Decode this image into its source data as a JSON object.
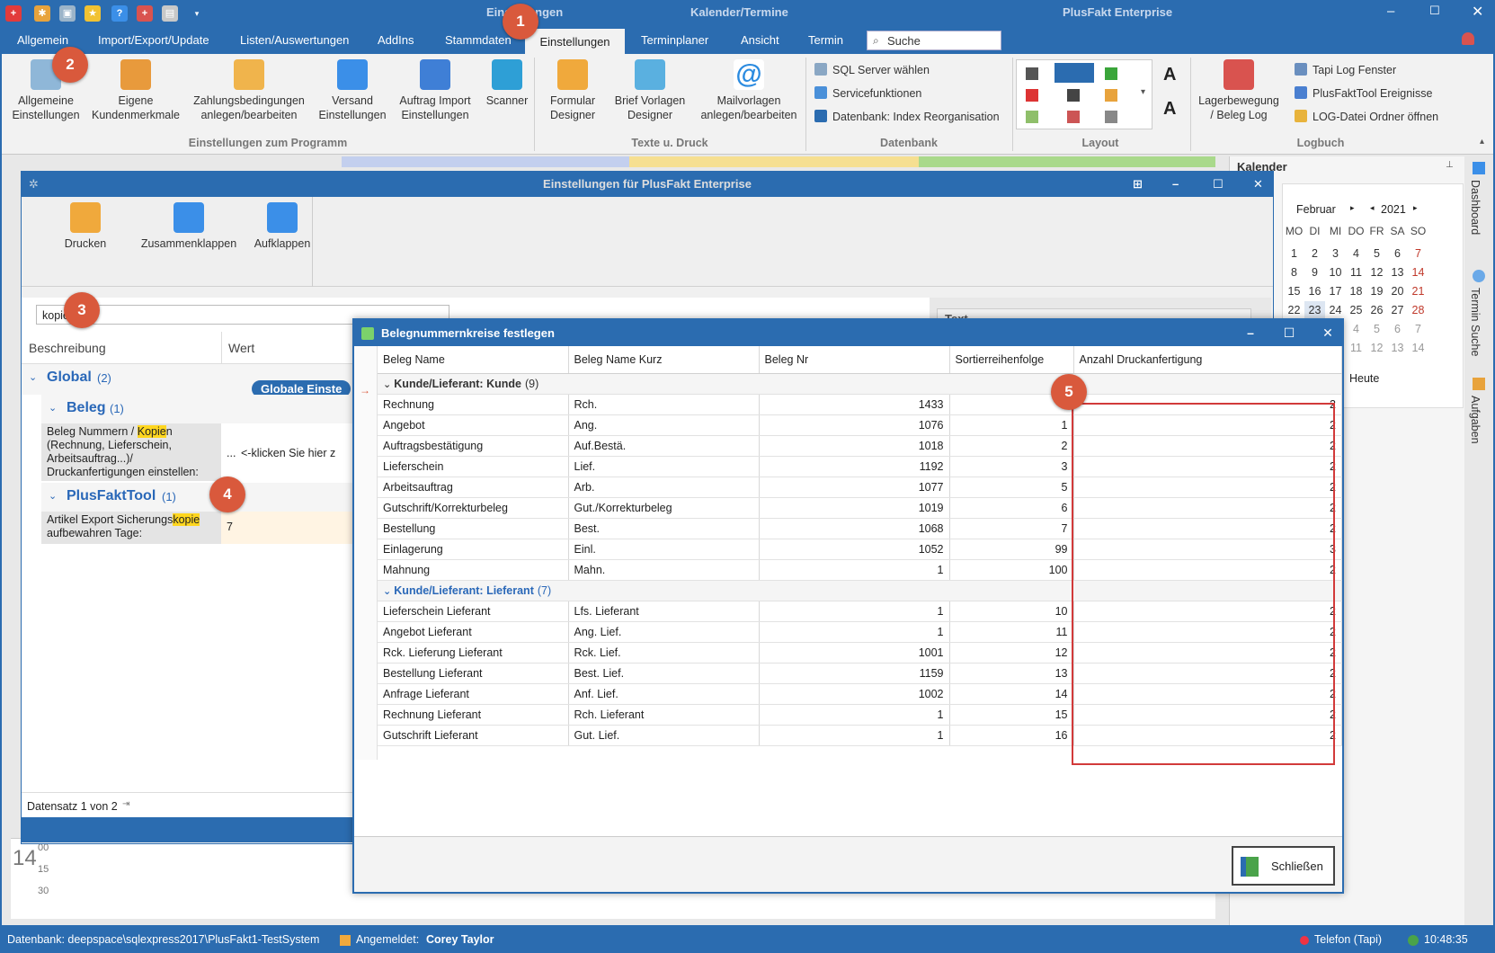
{
  "app": {
    "left_title": "Einstellungen",
    "center_title": "Kalender/Termine",
    "right_title": "PlusFakt Enterprise"
  },
  "menu": {
    "items": [
      "Allgemein",
      "Import/Export/Update",
      "Listen/Auswertungen",
      "AddIns",
      "Stammdaten",
      "Einstellungen",
      "Terminplaner",
      "Ansicht",
      "Termin"
    ],
    "search_placeholder": "Suche"
  },
  "ribbon": {
    "programm": {
      "buttons": [
        "Allgemeine\nEinstellungen",
        "Eigene\nKundenmerkmale",
        "Zahlungsbedingungen\nanlegen/bearbeiten",
        "Versand\nEinstellungen",
        "Auftrag Import\nEinstellungen",
        "Scanner"
      ],
      "label": "Einstellungen zum Programm"
    },
    "texte": {
      "buttons": [
        "Formular\nDesigner",
        "Brief Vorlagen\nDesigner",
        "Mailvorlagen\nanlegen/bearbeiten"
      ],
      "label": "Texte u. Druck"
    },
    "datenbank": {
      "cmds": [
        "SQL Server wählen",
        "Servicefunktionen",
        "Datenbank: Index Reorganisation"
      ],
      "label": "Datenbank"
    },
    "layout": {
      "label": "Layout"
    },
    "logbuch": {
      "button": "Lagerbewegung\n/ Beleg Log",
      "cmds": [
        "Tapi Log Fenster",
        "PlusFaktTool Ereignisse",
        "LOG-Datei Ordner öffnen"
      ],
      "label": "Logbuch"
    }
  },
  "settings_window": {
    "title": "Einstellungen für PlusFakt Enterprise",
    "toolbar": [
      "Drucken",
      "Zusammenklappen",
      "Aufklappen"
    ],
    "search_value": "kopie",
    "col_beschreibung": "Beschreibung",
    "col_wert": "Wert",
    "text_panel": "Text",
    "group_global": "Global",
    "group_global_count": "(2)",
    "globale_tag": "Globale Einste",
    "group_beleg": "Beleg",
    "group_beleg_count": "(1)",
    "row1_desc_a": "Beleg Nummern / ",
    "row1_desc_hl": "Kopie",
    "row1_desc_b": "n (Rechnung, Lieferschein, Arbeitsauftrag...)/ Druckanfertigungen einstellen:",
    "row1_value": "<-klicken Sie hier z",
    "row1_ellipsis": "...",
    "group_tool": "PlusFaktTool",
    "group_tool_count": "(1)",
    "row2_desc_a": "Artikel Export Sicherungs",
    "row2_desc_hl": "kopie",
    "row2_desc_b": " aufbewahren Tage:",
    "row2_value": "7",
    "record_nav": "Datensatz 1 von 2"
  },
  "calendar": {
    "title": "Kalender",
    "month": "Februar",
    "year": "2021",
    "weekdays": [
      "MO",
      "DI",
      "MI",
      "DO",
      "FR",
      "SA",
      "SO"
    ],
    "weeks": [
      [
        "1",
        "2",
        "3",
        "4",
        "5",
        "6",
        "7"
      ],
      [
        "8",
        "9",
        "10",
        "11",
        "12",
        "13",
        "14"
      ],
      [
        "15",
        "16",
        "17",
        "18",
        "19",
        "20",
        "21"
      ],
      [
        "22",
        "23",
        "24",
        "25",
        "26",
        "27",
        "28"
      ],
      [
        "1",
        "2",
        "3",
        "4",
        "5",
        "6",
        "7"
      ],
      [
        "8",
        "9",
        "10",
        "11",
        "12",
        "13",
        "14"
      ]
    ],
    "heute": "Heute"
  },
  "side_tabs": [
    "Dashboard",
    "Termin Suche",
    "Aufgaben"
  ],
  "schedule": {
    "times": [
      "00",
      "15",
      "30"
    ],
    "hour": "14"
  },
  "beleg_dialog": {
    "title": "Belegnummernkreise festlegen",
    "columns": [
      "Beleg Name",
      "Beleg Name Kurz",
      "Beleg Nr",
      "Sortierreihenfolge",
      "Anzahl Druckanfertigung"
    ],
    "groups": [
      {
        "label": "Kunde/Lieferant: Kunde",
        "count": "(9)",
        "rows": [
          [
            "Rechnung",
            "Rch.",
            "1433",
            "0",
            "2"
          ],
          [
            "Angebot",
            "Ang.",
            "1076",
            "1",
            "2"
          ],
          [
            "Auftragsbestätigung",
            "Auf.Bestä.",
            "1018",
            "2",
            "2"
          ],
          [
            "Lieferschein",
            "Lief.",
            "1192",
            "3",
            "2"
          ],
          [
            "Arbeitsauftrag",
            "Arb.",
            "1077",
            "5",
            "2"
          ],
          [
            "Gutschrift/Korrekturbeleg",
            "Gut./Korrekturbeleg",
            "1019",
            "6",
            "2"
          ],
          [
            "Bestellung",
            "Best.",
            "1068",
            "7",
            "2"
          ],
          [
            "Einlagerung",
            "Einl.",
            "1052",
            "99",
            "3"
          ],
          [
            "Mahnung",
            "Mahn.",
            "1",
            "100",
            "2"
          ]
        ]
      },
      {
        "label": "Kunde/Lieferant: Lieferant",
        "count": "(7)",
        "rows": [
          [
            "Lieferschein Lieferant",
            "Lfs. Lieferant",
            "1",
            "10",
            "2"
          ],
          [
            "Angebot Lieferant",
            "Ang. Lief.",
            "1",
            "11",
            "2"
          ],
          [
            "Rck. Lieferung Lieferant",
            "Rck. Lief.",
            "1001",
            "12",
            "2"
          ],
          [
            "Bestellung Lieferant",
            "Best. Lief.",
            "1159",
            "13",
            "2"
          ],
          [
            "Anfrage Lieferant",
            "Anf. Lief.",
            "1002",
            "14",
            "2"
          ],
          [
            "Rechnung Lieferant",
            "Rch. Lieferant",
            "1",
            "15",
            "2"
          ],
          [
            "Gutschrift Lieferant",
            "Gut. Lief.",
            "1",
            "16",
            "2"
          ]
        ]
      }
    ],
    "close_button": "Schließen"
  },
  "status": {
    "db_label": "Datenbank: deepspace\\sqlexpress2017\\PlusFakt1-TestSystem",
    "user_label": "Angemeldet:",
    "user_name": "Corey Taylor",
    "phone": "Telefon (Tapi)",
    "time": "10:48:35"
  },
  "badges": [
    "1",
    "2",
    "3",
    "4",
    "5"
  ],
  "colors": {
    "accent": "#2b6cb0",
    "badge": "#d9593c",
    "highlight_border": "#d23a3a",
    "group_link": "#2a68b8"
  }
}
